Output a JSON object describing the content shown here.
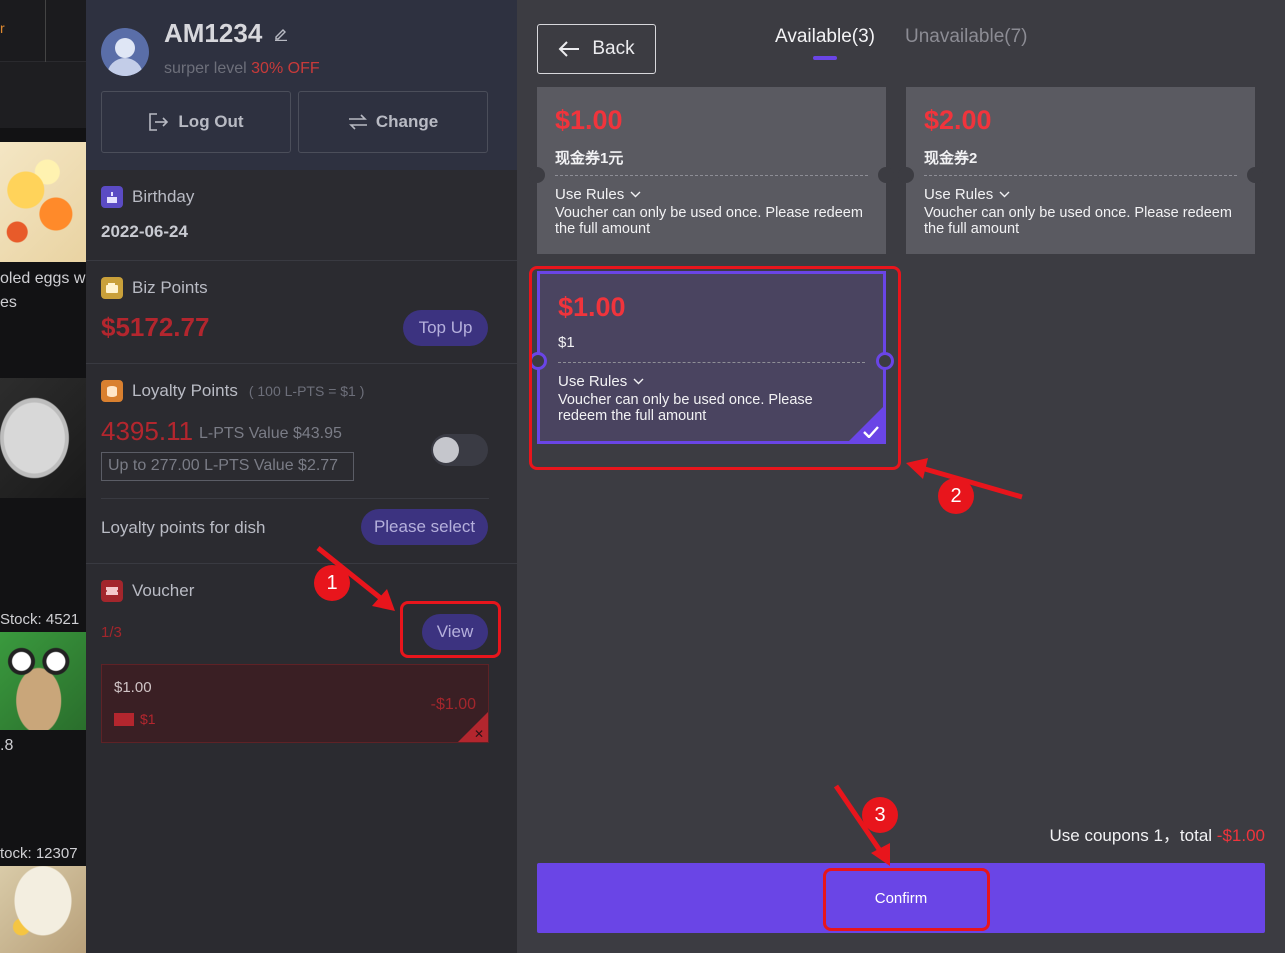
{
  "food_strip": {
    "texts": [
      "oled eggs w",
      "es",
      "Stock:  4521",
      ".8",
      "tock:  12307"
    ]
  },
  "profile": {
    "username": "AM1234",
    "level_prefix": "surper level",
    "level_discount": "30% OFF",
    "logout_label": "Log Out",
    "change_label": "Change"
  },
  "birthday": {
    "label": "Birthday",
    "value": "2022-06-24"
  },
  "biz_points": {
    "label": "Biz Points",
    "value": "$5172.77",
    "topup_label": "Top Up"
  },
  "loyalty": {
    "label": "Loyalty Points",
    "rate_note": "( 100 L-PTS = $1 )",
    "value": "4395.11",
    "value_note": "L-PTS Value $43.95",
    "limit_text": "Up to 277.00 L-PTS Value $2.77",
    "toggle_on": false,
    "dish_label": "Loyalty points for dish",
    "dish_button": "Please select"
  },
  "voucher": {
    "label": "Voucher",
    "count": "1/3",
    "view_label": "View",
    "applied": {
      "amount": "$1.00",
      "name": "$1",
      "discount": "-$1.00"
    }
  },
  "voucher_panel": {
    "back_label": "Back",
    "tab_available": "Available(3)",
    "tab_unavailable": "Unavailable(7)",
    "coupons": [
      {
        "amount": "$1.00",
        "name": "现金券1元",
        "rules_label": "Use Rules",
        "description": "Voucher can only be used once. Please redeem the full amount",
        "selected": false
      },
      {
        "amount": "$2.00",
        "name": "现金券2",
        "rules_label": "Use Rules",
        "description": "Voucher can only be used once. Please redeem the full amount",
        "selected": false
      },
      {
        "amount": "$1.00",
        "name": "$1",
        "rules_label": "Use Rules",
        "description": "Voucher can only be used once. Please redeem the full amount",
        "selected": true
      }
    ],
    "summary_text": "Use coupons 1，total",
    "summary_total": "-$1.00",
    "confirm_label": "Confirm"
  },
  "annotations": {
    "step1": "1",
    "step2": "2",
    "step3": "3"
  },
  "colors": {
    "accent": "#6a45e6",
    "price_red": "#f0343c",
    "annotation_red": "#e8151c"
  }
}
